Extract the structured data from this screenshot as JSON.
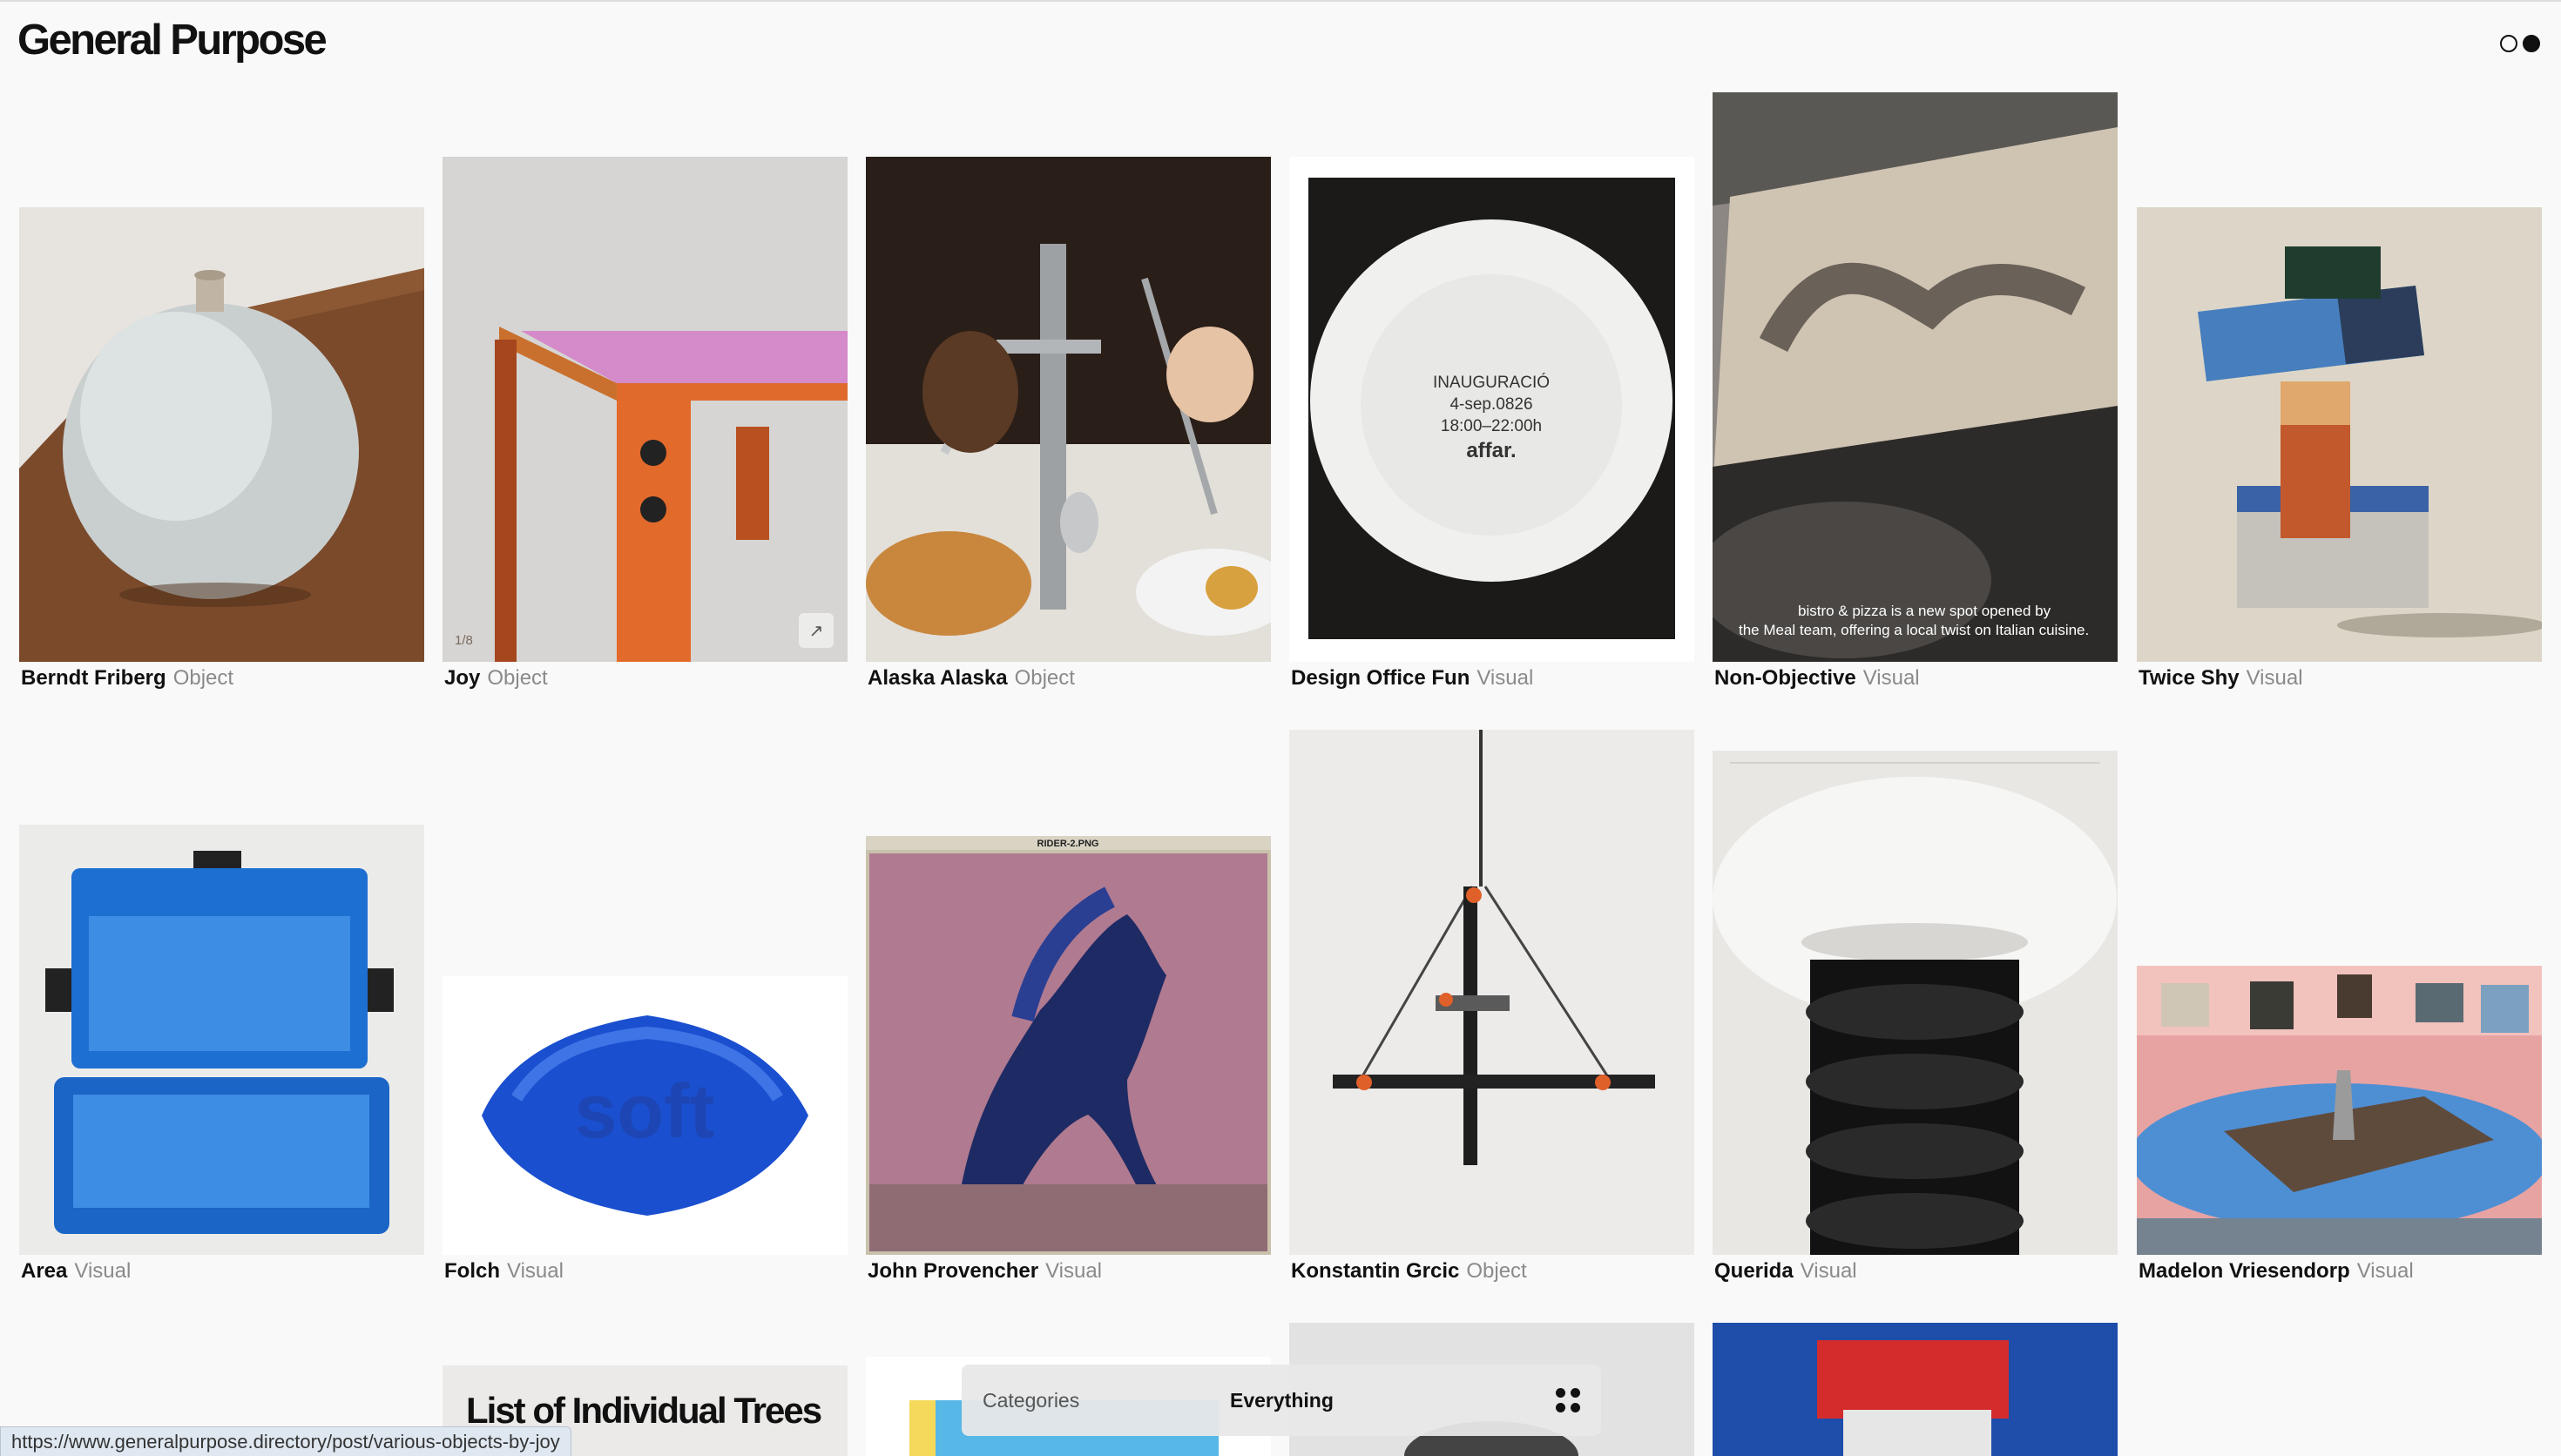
{
  "header": {
    "brand": "General Purpose",
    "toggle": [
      "light-mode",
      "dark-mode"
    ]
  },
  "cards": [
    {
      "title": "Berndt Friberg",
      "category": "Object"
    },
    {
      "title": "Joy",
      "category": "Object",
      "counter": "1/8",
      "expand_icon": "arrow-up-right-icon"
    },
    {
      "title": "Alaska Alaska",
      "category": "Object"
    },
    {
      "title": "Design Office Fun",
      "category": "Visual",
      "image_text": [
        "INAUGURACIÓ",
        "4-sep.0826",
        "18:00–22:00h",
        "affar."
      ]
    },
    {
      "title": "Non-Objective",
      "category": "Visual",
      "image_text": [
        "bistro & pizza is a new spot opened by",
        "the Meal team, offering a local twist on Italian cuisine."
      ]
    },
    {
      "title": "Twice Shy",
      "category": "Visual"
    },
    {
      "title": "Area",
      "category": "Visual"
    },
    {
      "title": "Folch",
      "category": "Visual",
      "image_text": [
        "soft"
      ]
    },
    {
      "title": "John Provencher",
      "category": "Visual",
      "image_text": [
        "RIDER-2.PNG"
      ]
    },
    {
      "title": "Konstantin Grcic",
      "category": "Object"
    },
    {
      "title": "Querida",
      "category": "Visual"
    },
    {
      "title": "Madelon Vriesendorp",
      "category": "Visual"
    }
  ],
  "row3": {
    "title_fragment": "List of Individual Trees"
  },
  "filter": {
    "label": "Categories",
    "value": "Everything",
    "icon": "grid-dots-icon"
  },
  "status_url": "https://www.generalpurpose.directory/post/various-objects-by-joy",
  "colors": {
    "background": "#f9f9f9",
    "text": "#111111",
    "muted": "#8a8a8a"
  }
}
